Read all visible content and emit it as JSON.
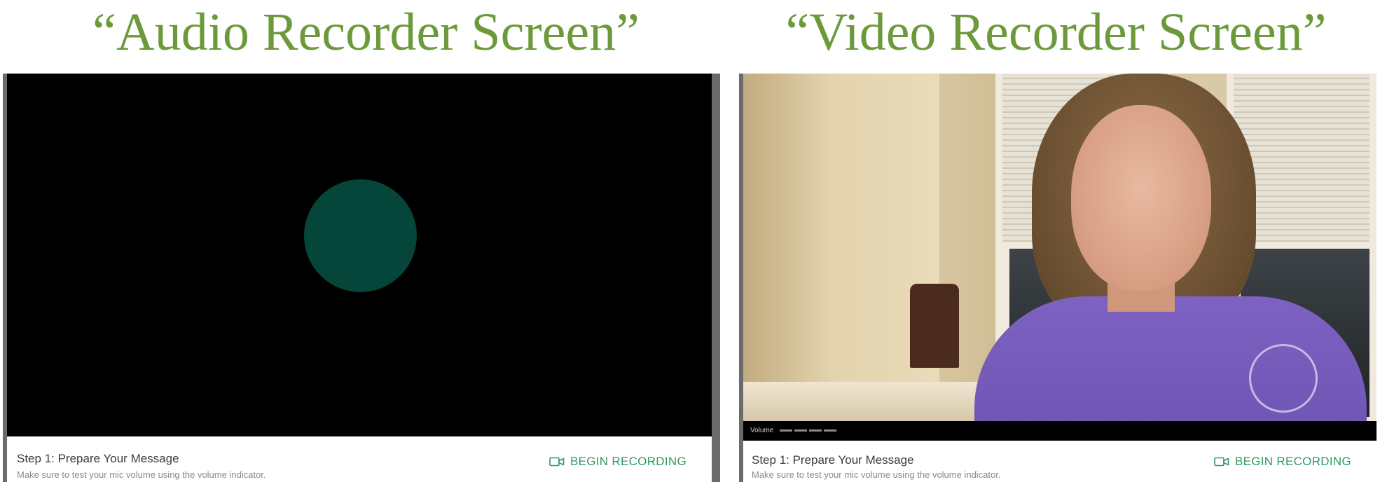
{
  "titles": {
    "audio": "“Audio Recorder Screen”",
    "video": "“Video Recorder Screen”"
  },
  "audio_panel": {
    "step_title": "Step 1: Prepare Your Message",
    "step_desc": "Make sure to test your mic volume using the volume indicator.",
    "begin_label": "BEGIN RECORDING",
    "mic_indicator_color": "#06463a"
  },
  "video_panel": {
    "volume_label": "Volume",
    "volume_level": 0,
    "step_title": "Step 1: Prepare Your Message",
    "step_desc": "Make sure to test your mic volume using the volume indicator.",
    "begin_label": "BEGIN RECORDING"
  },
  "colors": {
    "title_green": "#6c9a3b",
    "button_green": "#2e9a61"
  },
  "icons": {
    "begin_recording": "video-camera-icon"
  }
}
